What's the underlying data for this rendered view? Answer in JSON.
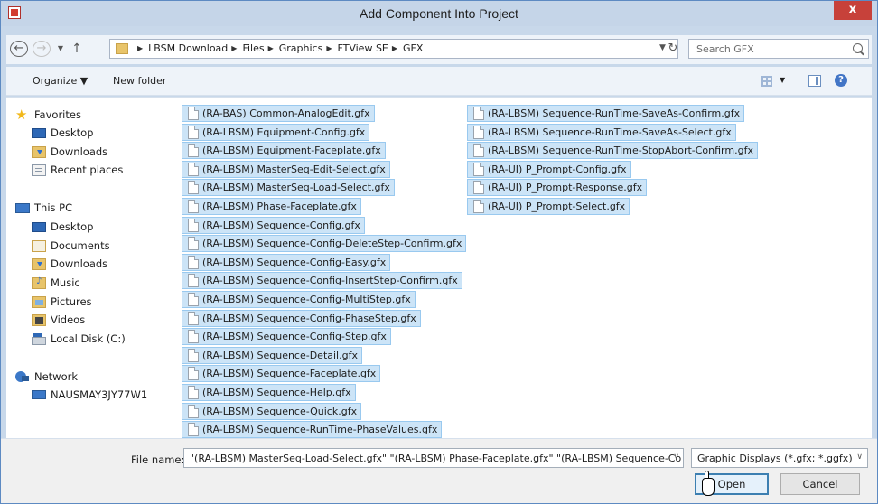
{
  "window": {
    "title": "Add Component Into Project",
    "close_label": "x"
  },
  "nav": {
    "back": "←",
    "forward": "→",
    "recent_drop": "▼",
    "up": "↑"
  },
  "address": {
    "crumbs": [
      "LBSM Download",
      "Files",
      "Graphics",
      "FTView SE",
      "GFX"
    ],
    "separator": "▶",
    "dropdown": "▼",
    "refresh": "↻"
  },
  "search": {
    "placeholder": "Search GFX"
  },
  "toolbar": {
    "organize": "Organize ▼",
    "new_folder": "New folder",
    "view_drop": "▼",
    "help": "?"
  },
  "sidebar": {
    "favorites": {
      "label": "Favorites",
      "items": [
        "Desktop",
        "Downloads",
        "Recent places"
      ]
    },
    "this_pc": {
      "label": "This PC",
      "items": [
        "Desktop",
        "Documents",
        "Downloads",
        "Music",
        "Pictures",
        "Videos",
        "Local Disk (C:)"
      ]
    },
    "network": {
      "label": "Network",
      "items": [
        "NAUSMAY3JY77W1"
      ]
    }
  },
  "files": [
    "(RA-BAS) Common-AnalogEdit.gfx",
    "(RA-LBSM) Equipment-Config.gfx",
    "(RA-LBSM) Equipment-Faceplate.gfx",
    "(RA-LBSM) MasterSeq-Edit-Select.gfx",
    "(RA-LBSM) MasterSeq-Load-Select.gfx",
    "(RA-LBSM) Phase-Faceplate.gfx",
    "(RA-LBSM) Sequence-Config.gfx",
    "(RA-LBSM) Sequence-Config-DeleteStep-Confirm.gfx",
    "(RA-LBSM) Sequence-Config-Easy.gfx",
    "(RA-LBSM) Sequence-Config-InsertStep-Confirm.gfx",
    "(RA-LBSM) Sequence-Config-MultiStep.gfx",
    "(RA-LBSM) Sequence-Config-PhaseStep.gfx",
    "(RA-LBSM) Sequence-Config-Step.gfx",
    "(RA-LBSM) Sequence-Detail.gfx",
    "(RA-LBSM) Sequence-Faceplate.gfx",
    "(RA-LBSM) Sequence-Help.gfx",
    "(RA-LBSM) Sequence-Quick.gfx",
    "(RA-LBSM) Sequence-RunTime-PhaseValues.gfx",
    "(RA-LBSM) Sequence-RunTime-SaveAs-Confirm.gfx",
    "(RA-LBSM) Sequence-RunTime-SaveAs-Select.gfx",
    "(RA-LBSM) Sequence-RunTime-StopAbort-Confirm.gfx",
    "(RA-UI) P_Prompt-Config.gfx",
    "(RA-UI) P_Prompt-Response.gfx",
    "(RA-UI) P_Prompt-Select.gfx"
  ],
  "footer": {
    "file_name_label": "File name:",
    "file_name_value": "\"(RA-LBSM) MasterSeq-Load-Select.gfx\" \"(RA-LBSM) Phase-Faceplate.gfx\" \"(RA-LBSM) Sequence-Co",
    "file_type": "Graphic Displays (*.gfx; *.ggfx)",
    "open_label": "Open",
    "cancel_label": "Cancel",
    "dropdown": "∨"
  }
}
